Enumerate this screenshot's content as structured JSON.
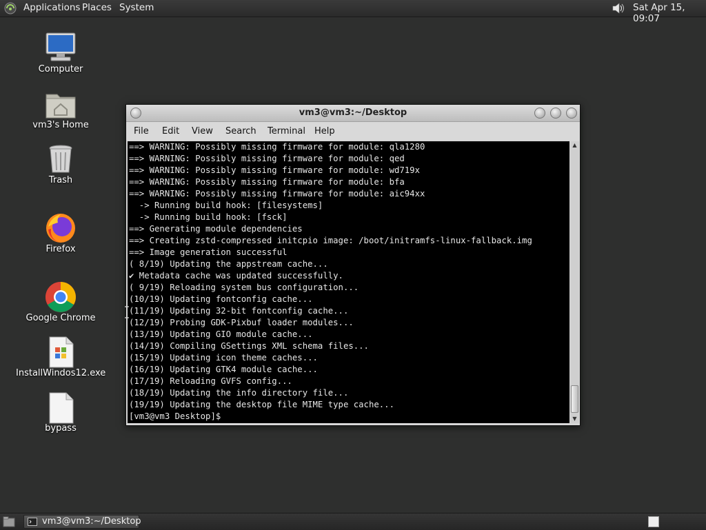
{
  "top_panel": {
    "menus": [
      "Applications",
      "Places",
      "System"
    ],
    "clock": "Sat Apr 15, 09:07"
  },
  "desktop_icons": [
    {
      "label": "Computer",
      "icon": "computer-icon"
    },
    {
      "label": "vm3's Home",
      "icon": "home-folder-icon"
    },
    {
      "label": "Trash",
      "icon": "trash-icon"
    },
    {
      "label": "Firefox",
      "icon": "firefox-icon"
    },
    {
      "label": "Google Chrome",
      "icon": "chrome-icon"
    },
    {
      "label": "InstallWindos12.exe",
      "icon": "exe-file-icon"
    },
    {
      "label": "bypass",
      "icon": "blank-file-icon"
    }
  ],
  "terminal": {
    "title": "vm3@vm3:~/Desktop",
    "menu": [
      "File",
      "Edit",
      "View",
      "Search",
      "Terminal",
      "Help"
    ],
    "lines": [
      "==> WARNING: Possibly missing firmware for module: qla1280",
      "==> WARNING: Possibly missing firmware for module: qed",
      "==> WARNING: Possibly missing firmware for module: wd719x",
      "==> WARNING: Possibly missing firmware for module: bfa",
      "==> WARNING: Possibly missing firmware for module: aic94xx",
      "  -> Running build hook: [filesystems]",
      "  -> Running build hook: [fsck]",
      "==> Generating module dependencies",
      "==> Creating zstd-compressed initcpio image: /boot/initramfs-linux-fallback.img",
      "==> Image generation successful",
      "( 8/19) Updating the appstream cache...",
      "✔ Metadata cache was updated successfully.",
      "( 9/19) Reloading system bus configuration...",
      "(10/19) Updating fontconfig cache...",
      "(11/19) Updating 32-bit fontconfig cache...",
      "(12/19) Probing GDK-Pixbuf loader modules...",
      "(13/19) Updating GIO module cache...",
      "(14/19) Compiling GSettings XML schema files...",
      "(15/19) Updating icon theme caches...",
      "(16/19) Updating GTK4 module cache...",
      "(17/19) Reloading GVFS config...",
      "(18/19) Updating the info directory file...",
      "(19/19) Updating the desktop file MIME type cache...",
      "[vm3@vm3 Desktop]$ "
    ]
  },
  "taskbar": {
    "task_label": "vm3@vm3:~/Desktop"
  }
}
